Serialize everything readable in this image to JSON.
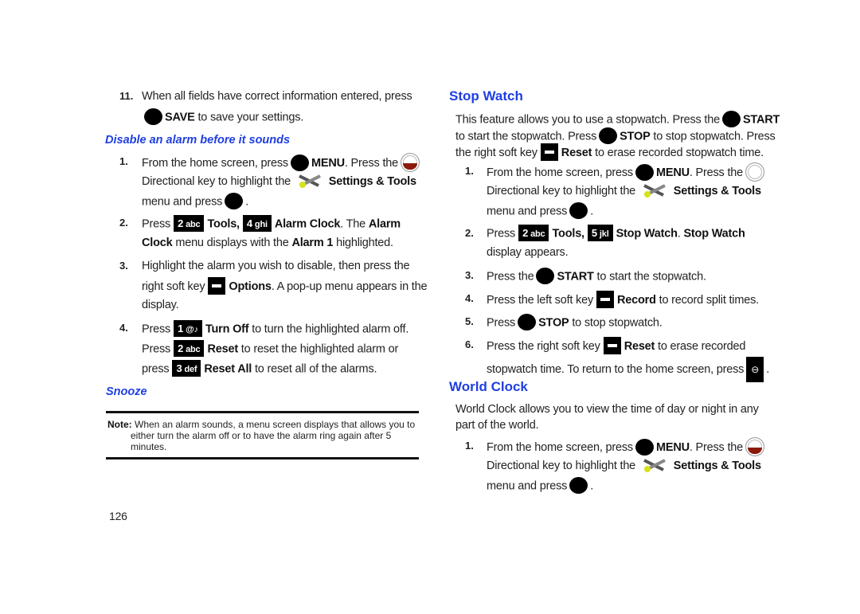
{
  "page_number": "126",
  "left": {
    "step11": {
      "number": "11.",
      "line1": "When all fields have correct information entered, press",
      "save_label": "SAVE",
      "line2_rest": " to save your settings."
    },
    "disable_heading": "Disable an alarm before it sounds",
    "disable_steps": {
      "s1": {
        "number": "1.",
        "a": "From the home screen, press",
        "menu": "MENU",
        "b": ". Press the",
        "c": "Directional key to highlight the",
        "settings": "Settings & Tools",
        "d": "menu and press",
        "e": "."
      },
      "s2": {
        "number": "2.",
        "a": "Press",
        "key2": "abc",
        "key2d": "2",
        "tools": "Tools,",
        "key4": "ghi",
        "key4d": "4",
        "alarm_clock": "Alarm Clock",
        "b": ". The ",
        "alarm": "Alarm",
        "clock": "Clock",
        "c": " menu displays with the ",
        "alarm1": "Alarm 1",
        "d": " highlighted."
      },
      "s3": {
        "number": "3.",
        "a": "Highlight the alarm you wish to disable, then press the",
        "b": "right soft key",
        "options": "Options",
        "c": ". A pop-up menu appears in the",
        "d": "display."
      },
      "s4": {
        "number": "4.",
        "a": "Press",
        "key1": "@♪",
        "key1d": "1",
        "turnoff": "Turn Off",
        "b": " to turn the highlighted alarm off.",
        "c": "Press",
        "key2": "abc",
        "key2d": "2",
        "reset": "Reset",
        "d": " to reset the highlighted alarm or",
        "e": "press",
        "key3": "def",
        "key3d": "3",
        "resetall": "Reset All",
        "f": " to reset all of the alarms."
      }
    },
    "snooze_heading": "Snooze",
    "note": {
      "label": "Note:",
      "line1": " When an alarm sounds, a menu screen displays that allows you to",
      "line2": "either turn the alarm off or to have the alarm ring again after 5",
      "line3": "minutes."
    }
  },
  "right": {
    "stopwatch_heading": "Stop Watch",
    "intro": {
      "l1a": "This feature allows you to use a stopwatch. Press the",
      "start": "START",
      "l2a": "to start the stopwatch. Press",
      "stop": "STOP",
      "l2b": " to stop stopwatch. Press",
      "l3a": "the right soft key",
      "reset": "Reset",
      "l3b": " to erase recorded stopwatch time."
    },
    "steps": {
      "s1": {
        "number": "1.",
        "a": "From the home screen, press",
        "menu": "MENU",
        "b": ". Press the",
        "c": "Directional key to highlight the",
        "settings": "Settings & Tools",
        "d": "menu and press",
        "e": "."
      },
      "s2": {
        "number": "2.",
        "a": "Press",
        "key2": "abc",
        "key2d": "2",
        "tools": "Tools,",
        "key5": "jkl",
        "key5d": "5",
        "sw": "Stop Watch",
        "b": ". ",
        "sw2": "Stop Watch",
        "c": "display appears."
      },
      "s3": {
        "number": "3.",
        "a": "Press the",
        "start": "START",
        "b": " to start the stopwatch."
      },
      "s4": {
        "number": "4.",
        "a": "Press the left soft key",
        "record": "Record",
        "b": " to record split times."
      },
      "s5": {
        "number": "5.",
        "a": "Press",
        "stop": "STOP",
        "b": " to stop stopwatch."
      },
      "s6": {
        "number": "6.",
        "a": "Press the right soft key",
        "reset": "Reset",
        "b": " to erase recorded",
        "c": "stopwatch time. To return to the home screen, press",
        "d": "."
      }
    },
    "worldclock_heading": "World Clock",
    "wc_intro": {
      "l1": "World Clock allows you to view the time of day or night in any",
      "l2": "part of the world."
    },
    "wc_steps": {
      "s1": {
        "number": "1.",
        "a": "From the home screen, press",
        "menu": "MENU",
        "b": ". Press the",
        "c": "Directional key to highlight the",
        "settings": "Settings & Tools",
        "d": "menu and press",
        "e": "."
      }
    }
  }
}
